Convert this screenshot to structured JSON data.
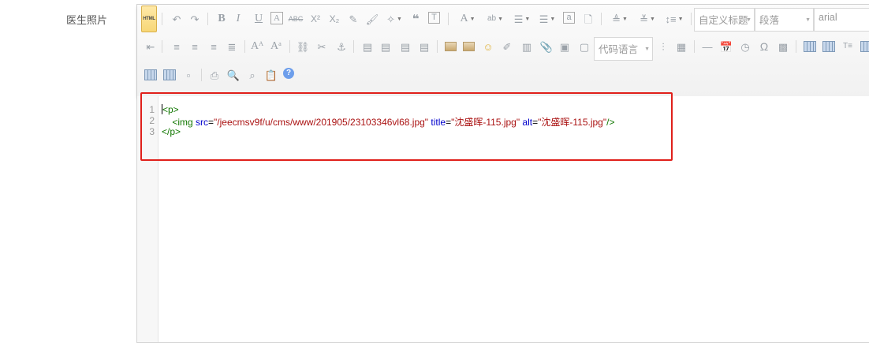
{
  "form": {
    "label": "医生照片"
  },
  "toolbar": {
    "html_button": "HTML",
    "font_family_placeholder": "自定义标题",
    "paragraph_placeholder": "段落",
    "font_name": "arial",
    "code_lang_placeholder": "代码语言"
  },
  "code": {
    "line_numbers": [
      "1",
      "2",
      "3"
    ],
    "line1_tag": "<p>",
    "line2_indent": "    ",
    "line2_open": "<img",
    "line2_attr1": " src",
    "line2_eq1": "=",
    "line2_val1": "\"/jeecmsv9f/u/cms/www/201905/23103346vl68.jpg\"",
    "line2_attr2": " title",
    "line2_eq2": "=",
    "line2_val2": "\"沈盛晖-115.jpg\"",
    "line2_attr3": " alt",
    "line2_eq3": "=",
    "line2_val3": "\"沈盛晖-115.jpg\"",
    "line2_close": "/>",
    "line3_tag": "</p>"
  },
  "colors": {
    "highlight": "#e0201b",
    "tag": "#117700",
    "attr": "#0000cc",
    "string": "#aa1111"
  }
}
